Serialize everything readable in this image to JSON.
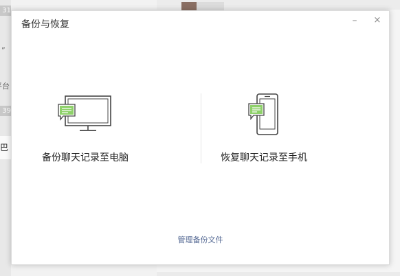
{
  "background": {
    "left_fragments": [
      "31",
      "”",
      "平台",
      "39",
      "巴"
    ],
    "thumb_color": "#8a6f63"
  },
  "dialog": {
    "title": "备份与恢复",
    "minimize_glyph": "–",
    "close_glyph": "×",
    "options": [
      {
        "label": "备份聊天记录至电脑",
        "icon": "monitor-chat-icon"
      },
      {
        "label": "恢复聊天记录至手机",
        "icon": "phone-chat-icon"
      }
    ],
    "manage_link": "管理备份文件"
  },
  "colors": {
    "accent_green": "#8ed16a",
    "link_blue": "#576b95",
    "icon_stroke": "#444444"
  }
}
